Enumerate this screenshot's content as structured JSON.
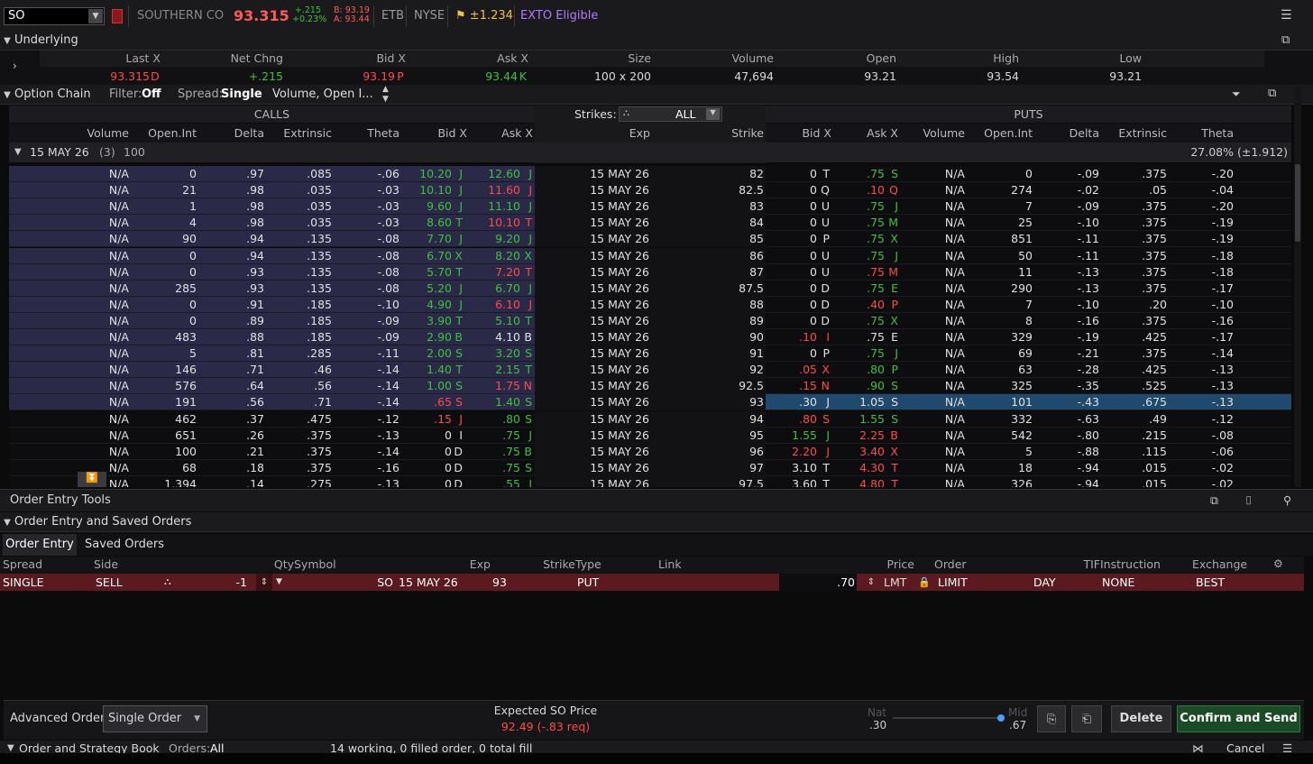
{
  "quote": {
    "symbol": "SO",
    "company": "SOUTHERN CO",
    "last": "93.315",
    "change_top": "+.215",
    "change_bottom": "+0.23%",
    "bid_line": "B: 93.19",
    "ask_line": "A: 93.44",
    "etb": "ETB",
    "exchange": "NYSE",
    "exp_move": "±1.234",
    "exto": "EXTO Eligible"
  },
  "underlying": {
    "title": "Underlying",
    "headers": [
      "Last X",
      "Net Chng",
      "Bid X",
      "Ask X",
      "Size",
      "Volume",
      "Open",
      "High",
      "Low"
    ],
    "values": [
      "93.315",
      "+.215",
      "93.19",
      "93.44",
      "100 x 200",
      "47,694",
      "93.21",
      "93.54",
      "93.21"
    ],
    "last_x": "D",
    "bid_x": "P",
    "ask_x": "K"
  },
  "chain": {
    "title": "Option Chain",
    "filter_label": "Filter:",
    "filter_value": "Off",
    "spread_label": "Spread:",
    "spread_value": "Single",
    "layout_value": "Volume, Open I...",
    "calls_label": "CALLS",
    "puts_label": "PUTS",
    "strikes_label": "Strikes:",
    "strikes_value": "ALL",
    "call_headers": [
      "Volume",
      "Open.Int",
      "Delta",
      "Extrinsic",
      "Theta",
      "Bid X",
      "Ask X"
    ],
    "mid_headers": [
      "Exp",
      "Strike"
    ],
    "put_headers": [
      "Bid X",
      "Ask X",
      "Volume",
      "Open.Int",
      "Delta",
      "Extrinsic",
      "Theta"
    ],
    "series_label": "15 MAY 26",
    "series_count": "(3)",
    "series_mult": "100",
    "series_iv": "27.08% (±1.912)",
    "rows": [
      [
        "N/A",
        "0",
        ".97",
        ".085",
        "-.06",
        "10.20",
        "J",
        "12.60",
        "J",
        "15 MAY 26",
        "82",
        "0",
        "T",
        ".75",
        "S",
        "N/A",
        "0",
        "-.09",
        ".375",
        "-.20"
      ],
      [
        "N/A",
        "21",
        ".98",
        ".035",
        "-.03",
        "10.10",
        "J",
        "11.60",
        "J",
        "15 MAY 26",
        "82.5",
        "0",
        "Q",
        ".10",
        "Q",
        "N/A",
        "274",
        "-.02",
        ".05",
        "-.04"
      ],
      [
        "N/A",
        "1",
        ".98",
        ".035",
        "-.03",
        "9.60",
        "J",
        "11.10",
        "J",
        "15 MAY 26",
        "83",
        "0",
        "U",
        ".75",
        "J",
        "N/A",
        "7",
        "-.09",
        ".375",
        "-.20"
      ],
      [
        "N/A",
        "4",
        ".98",
        ".035",
        "-.03",
        "8.60",
        "T",
        "10.10",
        "T",
        "15 MAY 26",
        "84",
        "0",
        "U",
        ".75",
        "M",
        "N/A",
        "25",
        "-.10",
        ".375",
        "-.19"
      ],
      [
        "N/A",
        "90",
        ".94",
        ".135",
        "-.08",
        "7.70",
        "J",
        "9.20",
        "J",
        "15 MAY 26",
        "85",
        "0",
        "P",
        ".75",
        "X",
        "N/A",
        "851",
        "-.11",
        ".375",
        "-.19"
      ],
      [
        "N/A",
        "0",
        ".94",
        ".135",
        "-.08",
        "6.70",
        "X",
        "8.20",
        "X",
        "15 MAY 26",
        "86",
        "0",
        "U",
        ".75",
        "J",
        "N/A",
        "50",
        "-.11",
        ".375",
        "-.18"
      ],
      [
        "N/A",
        "0",
        ".93",
        ".135",
        "-.08",
        "5.70",
        "T",
        "7.20",
        "T",
        "15 MAY 26",
        "87",
        "0",
        "U",
        ".75",
        "M",
        "N/A",
        "11",
        "-.13",
        ".375",
        "-.18"
      ],
      [
        "N/A",
        "285",
        ".93",
        ".135",
        "-.08",
        "5.20",
        "J",
        "6.70",
        "J",
        "15 MAY 26",
        "87.5",
        "0",
        "D",
        ".75",
        "E",
        "N/A",
        "290",
        "-.13",
        ".375",
        "-.17"
      ],
      [
        "N/A",
        "0",
        ".91",
        ".185",
        "-.10",
        "4.90",
        "J",
        "6.10",
        "J",
        "15 MAY 26",
        "88",
        "0",
        "D",
        ".40",
        "P",
        "N/A",
        "7",
        "-.10",
        ".20",
        "-.10"
      ],
      [
        "N/A",
        "0",
        ".89",
        ".185",
        "-.09",
        "3.90",
        "T",
        "5.10",
        "T",
        "15 MAY 26",
        "89",
        "0",
        "D",
        ".75",
        "X",
        "N/A",
        "8",
        "-.16",
        ".375",
        "-.16"
      ],
      [
        "N/A",
        "483",
        ".88",
        ".185",
        "-.09",
        "2.90",
        "B",
        "4.10",
        "B",
        "15 MAY 26",
        "90",
        ".10",
        "I",
        ".75",
        "E",
        "N/A",
        "329",
        "-.19",
        ".425",
        "-.17"
      ],
      [
        "N/A",
        "5",
        ".81",
        ".285",
        "-.11",
        "2.00",
        "S",
        "3.20",
        "S",
        "15 MAY 26",
        "91",
        "0",
        "P",
        ".75",
        "J",
        "N/A",
        "69",
        "-.21",
        ".375",
        "-.14"
      ],
      [
        "N/A",
        "146",
        ".71",
        ".46",
        "-.14",
        "1.40",
        "T",
        "2.15",
        "T",
        "15 MAY 26",
        "92",
        ".05",
        "X",
        ".80",
        "P",
        "N/A",
        "63",
        "-.28",
        ".425",
        "-.13"
      ],
      [
        "N/A",
        "576",
        ".64",
        ".56",
        "-.14",
        "1.00",
        "S",
        "1.75",
        "N",
        "15 MAY 26",
        "92.5",
        ".15",
        "N",
        ".90",
        "S",
        "N/A",
        "325",
        "-.35",
        ".525",
        "-.13"
      ],
      [
        "N/A",
        "191",
        ".56",
        ".71",
        "-.14",
        ".65",
        "S",
        "1.40",
        "S",
        "15 MAY 26",
        "93",
        ".30",
        "J",
        "1.05",
        "S",
        "N/A",
        "101",
        "-.43",
        ".675",
        "-.13"
      ],
      [
        "N/A",
        "462",
        ".37",
        ".475",
        "-.12",
        ".15",
        "J",
        ".80",
        "S",
        "15 MAY 26",
        "94",
        ".80",
        "S",
        "1.55",
        "S",
        "N/A",
        "332",
        "-.63",
        ".49",
        "-.12"
      ],
      [
        "N/A",
        "651",
        ".26",
        ".375",
        "-.13",
        "0",
        "I",
        ".75",
        "J",
        "15 MAY 26",
        "95",
        "1.55",
        "J",
        "2.25",
        "B",
        "N/A",
        "542",
        "-.80",
        ".215",
        "-.08"
      ],
      [
        "N/A",
        "100",
        ".21",
        ".375",
        "-.14",
        "0",
        "D",
        ".75",
        "B",
        "15 MAY 26",
        "96",
        "2.20",
        "J",
        "3.40",
        "X",
        "N/A",
        "5",
        "-.88",
        ".115",
        "-.06"
      ],
      [
        "N/A",
        "68",
        ".18",
        ".375",
        "-.16",
        "0",
        "D",
        ".75",
        "S",
        "15 MAY 26",
        "97",
        "3.10",
        "T",
        "4.30",
        "T",
        "N/A",
        "18",
        "-.94",
        ".015",
        "-.02"
      ],
      [
        "N/A",
        "1,394",
        ".14",
        ".275",
        "-.13",
        "0",
        "D",
        ".55",
        "J",
        "15 MAY 26",
        "97.5",
        "3.60",
        "T",
        "4.80",
        "T",
        "N/A",
        "326",
        "-.94",
        ".015",
        "-.02"
      ]
    ]
  },
  "order_tools": {
    "title": "Order Entry Tools",
    "section": "Order Entry and Saved Orders",
    "tabs": [
      "Order Entry",
      "Saved Orders"
    ],
    "headers": [
      "Spread",
      "Side",
      "Qty",
      "Symbol",
      "Exp",
      "Strike",
      "Type",
      "Link",
      "Price",
      "Order",
      "TIF",
      "Instruction",
      "Exchange"
    ],
    "row": {
      "spread": "SINGLE",
      "side": "SELL",
      "qty": "-1",
      "symbol": "SO",
      "exp": "15 MAY 26",
      "strike": "93",
      "type": "PUT",
      "price": ".70",
      "price_type": "LMT",
      "order": "LIMIT",
      "tif": "DAY",
      "instruction": "NONE",
      "exchange": "BEST"
    }
  },
  "footer": {
    "advanced_label": "Advanced Order:",
    "advanced_value": "Single Order",
    "expected_title": "Expected SO Price",
    "expected_value": "92.49 (-.83 req)",
    "nat_label": "Nat",
    "nat_value": ".30",
    "mid_label": "Mid",
    "mid_value": ".67",
    "delete": "Delete",
    "confirm": "Confirm and Send"
  },
  "bottom": {
    "title": "Order and Strategy Book",
    "orders_label": "Orders:",
    "orders_value": "All",
    "status": "14 working, 0 filled order, 0 total fill",
    "cancel": "Cancel"
  },
  "colors": {
    "call_itm_bg": "#2a2a48",
    "selected_row": "#1f4a6e",
    "confirm_bg": "#1b4a26",
    "order_row": "#5a1a20"
  }
}
